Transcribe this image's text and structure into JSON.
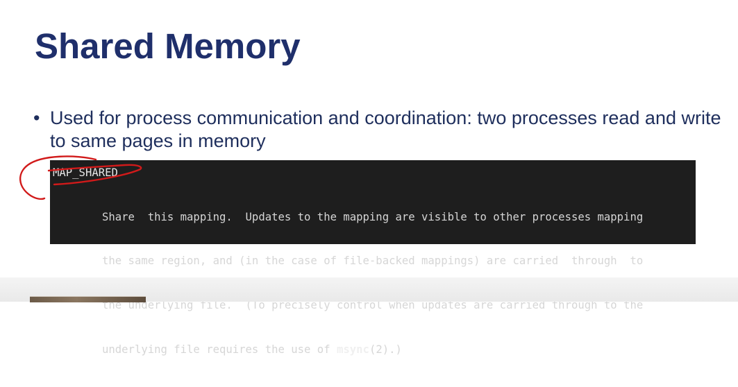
{
  "slide": {
    "title": "Shared Memory",
    "bullets": [
      {
        "marker": "•",
        "text": "Used for process communication and coordination: two processes read and write to same pages in memory"
      }
    ]
  },
  "manpage": {
    "flag": "MAP_SHARED",
    "lines": [
      {
        "before": "Share  this mapping.  Updates to the mapping are visible to other processes mapping",
        "bold": "",
        "after": ""
      },
      {
        "before": "the same region, and (in the case of file-backed mappings) are carried  through  to",
        "bold": "",
        "after": ""
      },
      {
        "before": "the underlying file.  (To precisely control when updates are carried through to the",
        "bold": "",
        "after": ""
      },
      {
        "before": "underlying file requires the use of ",
        "bold": "msync",
        "after": "(2).)"
      }
    ]
  },
  "colors": {
    "title": "#1f2f6b",
    "body_text": "#1e2e5c",
    "terminal_bg": "#1e1e1e",
    "annotation": "#d11a1a"
  }
}
